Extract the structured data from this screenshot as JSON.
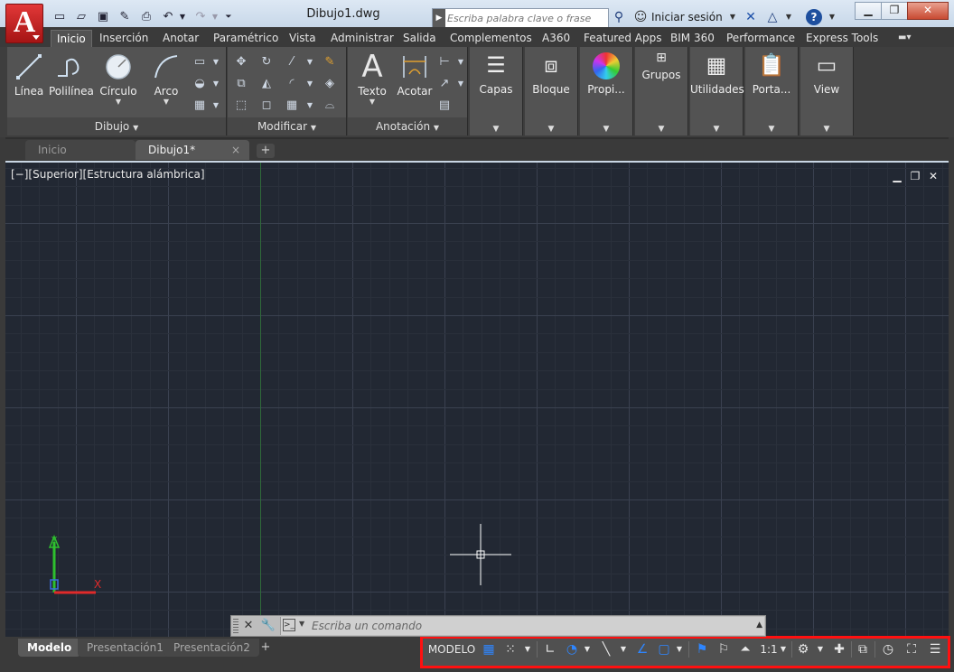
{
  "titlebar": {
    "app_logo": "A",
    "doc_title": "Dibujo1.dwg",
    "search_placeholder": "Escriba palabra clave o frase",
    "signin": "Iniciar sesión",
    "help": "?"
  },
  "ribbon_tabs": [
    "Inicio",
    "Inserción",
    "Anotar",
    "Paramétrico",
    "Vista",
    "Administrar",
    "Salida",
    "Complementos",
    "A360",
    "Featured Apps",
    "BIM 360",
    "Performance",
    "Express Tools"
  ],
  "panels": {
    "dibujo": {
      "title": "Dibujo",
      "linea": "Línea",
      "polilinea": "Polilínea",
      "circulo": "Círculo",
      "arco": "Arco"
    },
    "modificar": {
      "title": "Modificar"
    },
    "anotacion": {
      "title": "Anotación",
      "texto": "Texto",
      "acotar": "Acotar"
    },
    "capas": "Capas",
    "bloque": "Bloque",
    "propiedades": "Propi...",
    "grupos": "Grupos",
    "utilidades": "Utilidades",
    "portapapeles": "Porta...",
    "view": "View"
  },
  "file_tabs": {
    "start": "Inicio",
    "drawing": "Dibujo1*",
    "close": "×",
    "add": "+"
  },
  "viewport": {
    "label": "[−][Superior][Estructura alámbrica]"
  },
  "ucs": {
    "x": "X",
    "y": "Y"
  },
  "command": {
    "placeholder": "Escriba un comando"
  },
  "layout_tabs": [
    "Modelo",
    "Presentación1",
    "Presentación2"
  ],
  "status": {
    "model": "MODELO",
    "scale": "1:1"
  },
  "colors": {
    "accent_blue": "#2e86ff",
    "highlight_red": "#ff1010",
    "canvas": "#222833"
  }
}
